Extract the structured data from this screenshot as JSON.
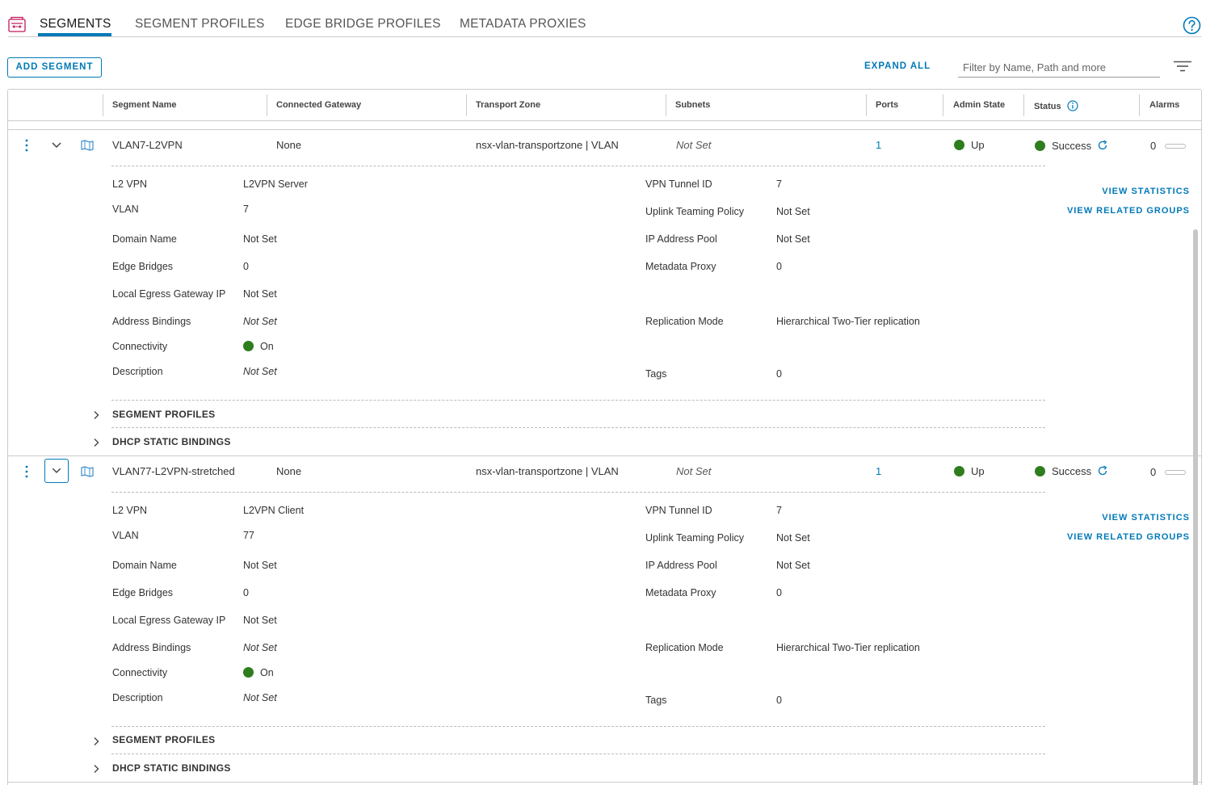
{
  "tabs": [
    {
      "label": "SEGMENTS",
      "active": true
    },
    {
      "label": "SEGMENT PROFILES",
      "active": false
    },
    {
      "label": "EDGE BRIDGE PROFILES",
      "active": false
    },
    {
      "label": "METADATA PROXIES",
      "active": false
    }
  ],
  "icons": {
    "app": "segments-icon",
    "help": "help-icon",
    "filter": "filter-icon"
  },
  "toolbar": {
    "add_label": "ADD SEGMENT",
    "expand_all": "EXPAND ALL",
    "filter_placeholder": "Filter by Name, Path and more"
  },
  "columns": [
    "Segment Name",
    "Connected Gateway",
    "Transport Zone",
    "Subnets",
    "Ports",
    "Admin State",
    "Status",
    "Alarms"
  ],
  "colors": {
    "accent": "#0079b8",
    "success": "#2e7d1e"
  },
  "segments": [
    {
      "name": "VLAN7-L2VPN",
      "gateway": "None",
      "transport_zone": "nsx-vlan-transportzone | VLAN",
      "subnets": "Not Set",
      "ports": "1",
      "admin_state": "Up",
      "status": "Success",
      "alarms": "0",
      "details_left": [
        {
          "label": "L2 VPN",
          "value": "L2VPN Server"
        },
        {
          "label": "VLAN",
          "value": "7"
        },
        {
          "label": "Domain Name",
          "value": "Not Set"
        },
        {
          "label": "Edge Bridges",
          "value": "0"
        },
        {
          "label": "Local Egress Gateway IP",
          "value": "Not Set"
        },
        {
          "label": "Address Bindings",
          "value": "Not Set"
        },
        {
          "label": "Connectivity",
          "value": "On"
        },
        {
          "label": "Description",
          "value": "Not Set"
        }
      ],
      "details_right": [
        {
          "label": "VPN Tunnel ID",
          "value": "7"
        },
        {
          "label": "Uplink Teaming Policy",
          "value": "Not Set"
        },
        {
          "label": "IP Address Pool",
          "value": "Not Set"
        },
        {
          "label": "Metadata Proxy",
          "value": "0"
        },
        {
          "label": "Replication Mode",
          "value": "Hierarchical Two-Tier replication"
        },
        {
          "label": "Tags",
          "value": "0"
        }
      ],
      "actions": [
        "VIEW STATISTICS",
        "VIEW RELATED GROUPS"
      ],
      "sections": [
        "SEGMENT PROFILES",
        "DHCP STATIC BINDINGS"
      ]
    },
    {
      "name": "VLAN77-L2VPN-stretched",
      "gateway": "None",
      "transport_zone": "nsx-vlan-transportzone | VLAN",
      "subnets": "Not Set",
      "ports": "1",
      "admin_state": "Up",
      "status": "Success",
      "alarms": "0",
      "details_left": [
        {
          "label": "L2 VPN",
          "value": "L2VPN Client"
        },
        {
          "label": "VLAN",
          "value": "77"
        },
        {
          "label": "Domain Name",
          "value": "Not Set"
        },
        {
          "label": "Edge Bridges",
          "value": "0"
        },
        {
          "label": "Local Egress Gateway IP",
          "value": "Not Set"
        },
        {
          "label": "Address Bindings",
          "value": "Not Set"
        },
        {
          "label": "Connectivity",
          "value": "On"
        },
        {
          "label": "Description",
          "value": "Not Set"
        }
      ],
      "details_right": [
        {
          "label": "VPN Tunnel ID",
          "value": "7"
        },
        {
          "label": "Uplink Teaming Policy",
          "value": "Not Set"
        },
        {
          "label": "IP Address Pool",
          "value": "Not Set"
        },
        {
          "label": "Metadata Proxy",
          "value": "0"
        },
        {
          "label": "Replication Mode",
          "value": "Hierarchical Two-Tier replication"
        },
        {
          "label": "Tags",
          "value": "0"
        }
      ],
      "actions": [
        "VIEW STATISTICS",
        "VIEW RELATED GROUPS"
      ],
      "sections": [
        "SEGMENT PROFILES",
        "DHCP STATIC BINDINGS"
      ]
    }
  ]
}
